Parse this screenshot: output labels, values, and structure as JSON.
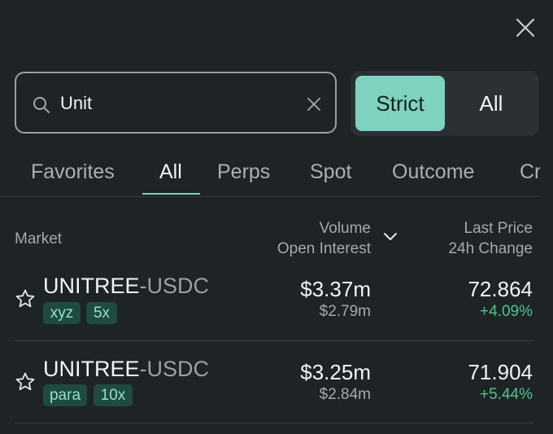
{
  "colors": {
    "accent": "#7dd3c0",
    "positive": "#4ec48f",
    "background": "#1e2326"
  },
  "icons": {
    "close": "close-icon",
    "search": "search-icon",
    "clear": "clear-icon",
    "sort": "chevron-down-icon",
    "favorite": "star-icon"
  },
  "search": {
    "value": "Unit"
  },
  "filter": {
    "strict": "Strict",
    "all": "All",
    "selected": "Strict"
  },
  "tabs": [
    {
      "label": "Favorites",
      "active": false
    },
    {
      "label": "All",
      "active": true
    },
    {
      "label": "Perps",
      "active": false
    },
    {
      "label": "Spot",
      "active": false
    },
    {
      "label": "Outcome",
      "active": false
    },
    {
      "label": "Cr",
      "active": false
    }
  ],
  "table": {
    "headers": {
      "market": "Market",
      "volume": "Volume",
      "open_interest": "Open Interest",
      "last_price": "Last Price",
      "change_24h": "24h Change"
    },
    "rows": [
      {
        "base": "UNITREE",
        "quote": "-USDC",
        "tags": [
          "xyz",
          "5x"
        ],
        "volume": "$3.37m",
        "open_interest": "$2.79m",
        "last_price": "72.864",
        "change_24h": "+4.09%"
      },
      {
        "base": "UNITREE",
        "quote": "-USDC",
        "tags": [
          "para",
          "10x"
        ],
        "volume": "$3.25m",
        "open_interest": "$2.84m",
        "last_price": "71.904",
        "change_24h": "+5.44%"
      }
    ]
  }
}
